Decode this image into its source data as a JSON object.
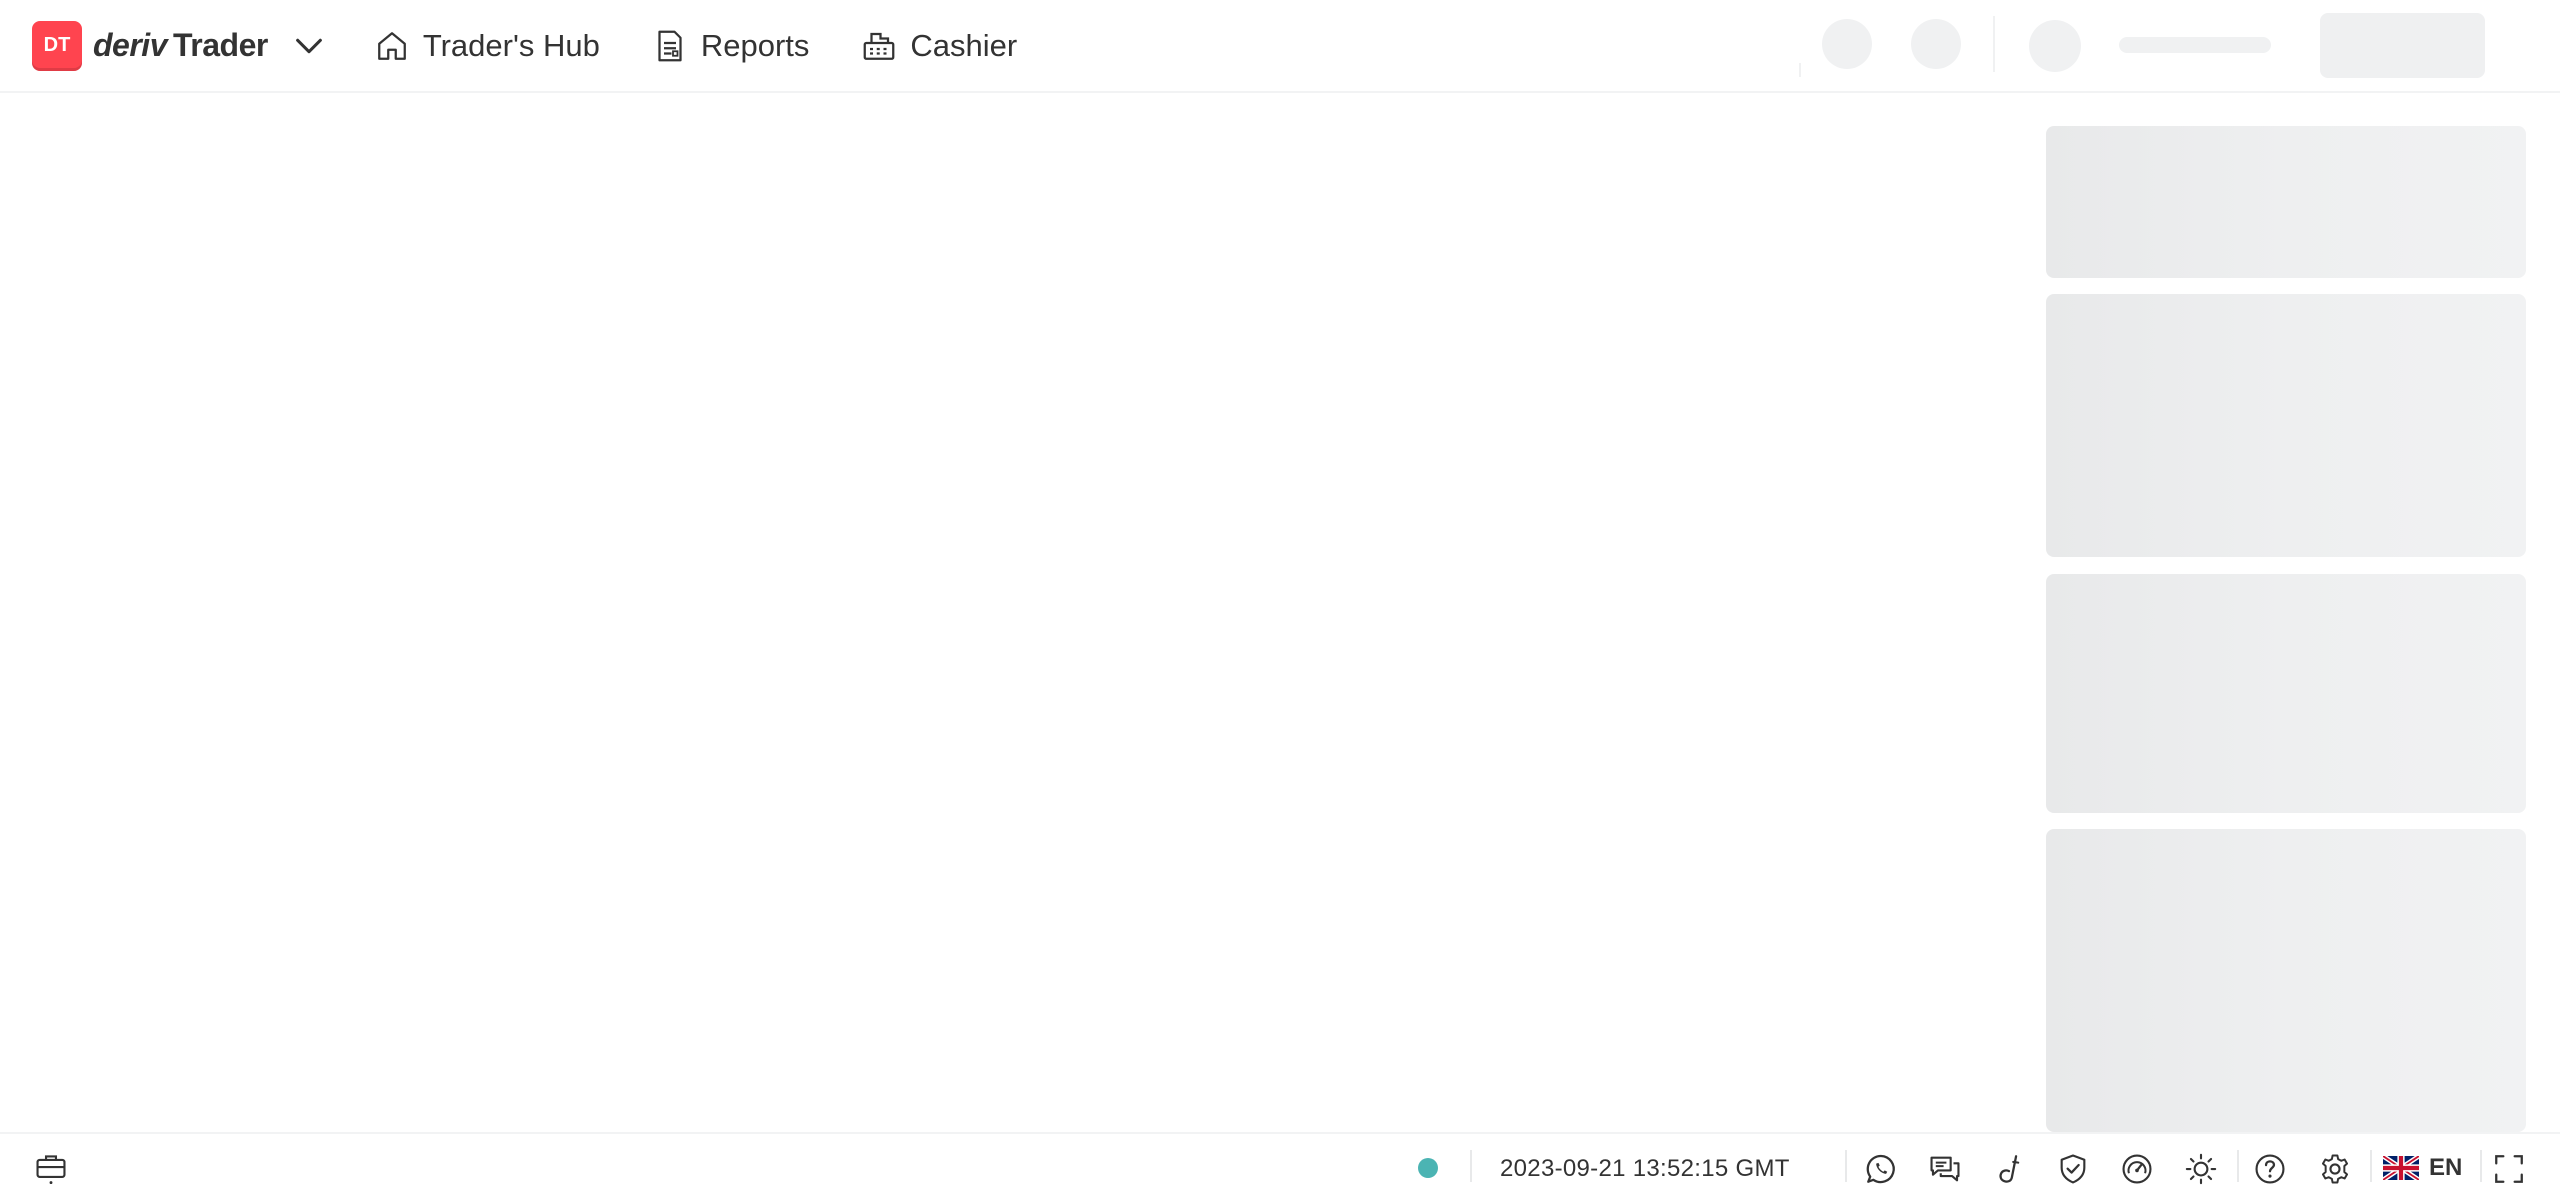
{
  "brand": {
    "logo_text": "DT",
    "name_part1": "deriv",
    "name_part2": "Trader",
    "accent_color": "#ff444f",
    "menu_icon": "chevron-down-icon"
  },
  "nav": [
    {
      "label": "Trader's Hub",
      "icon": "house-icon"
    },
    {
      "label": "Reports",
      "icon": "report-document-icon"
    },
    {
      "label": "Cashier",
      "icon": "cash-register-icon"
    }
  ],
  "footer": {
    "positions_icon": "briefcase-icon",
    "connection_status_color": "#4bb4b3",
    "server_time": "2023-09-21 13:52:15 GMT",
    "icons": [
      "whatsapp-icon",
      "live-chat-icon",
      "deriv-go-icon",
      "responsible-trading-shield-icon",
      "account-limits-gauge-icon",
      "theme-sun-icon",
      "help-center-question-icon",
      "settings-gear-icon"
    ],
    "language": {
      "flag": "uk-flag-icon",
      "code": "EN"
    },
    "fullscreen_icon": "fullscreen-icon"
  }
}
